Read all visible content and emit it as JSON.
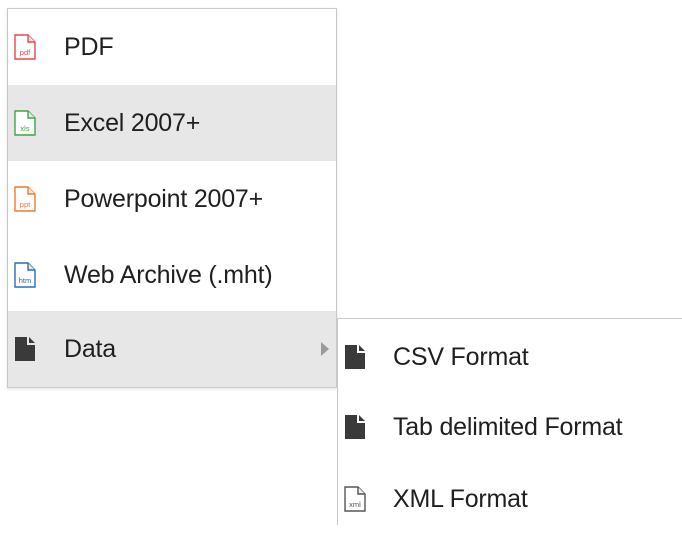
{
  "main_menu": {
    "items": [
      {
        "label": "PDF",
        "icon": "pdf-file-icon",
        "icon_text": "pdf",
        "color": "#e8484b"
      },
      {
        "label": "Excel 2007+",
        "icon": "excel-file-icon",
        "icon_text": "xls",
        "color": "#41a447"
      },
      {
        "label": "Powerpoint 2007+",
        "icon": "powerpoint-file-icon",
        "icon_text": "ppt",
        "color": "#ee7a36"
      },
      {
        "label": "Web Archive (.mht)",
        "icon": "web-archive-file-icon",
        "icon_text": "htm",
        "color": "#2d6bb5"
      },
      {
        "label": "Data",
        "icon": "data-file-icon",
        "has_submenu": true
      }
    ],
    "highlighted_item": "Excel 2007+"
  },
  "sub_menu": {
    "items": [
      {
        "label": "CSV Format",
        "icon": "csv-file-icon"
      },
      {
        "label": "Tab delimited Format",
        "icon": "tab-delimited-file-icon"
      },
      {
        "label": "XML Format",
        "icon": "xml-file-icon",
        "icon_text": "xml",
        "color": "#555555"
      }
    ]
  },
  "colors": {
    "hover_background": "#e7e7e7",
    "border": "#c9c9c9",
    "text": "#1f1f1f",
    "solid_icon": "#3a3a3a"
  }
}
